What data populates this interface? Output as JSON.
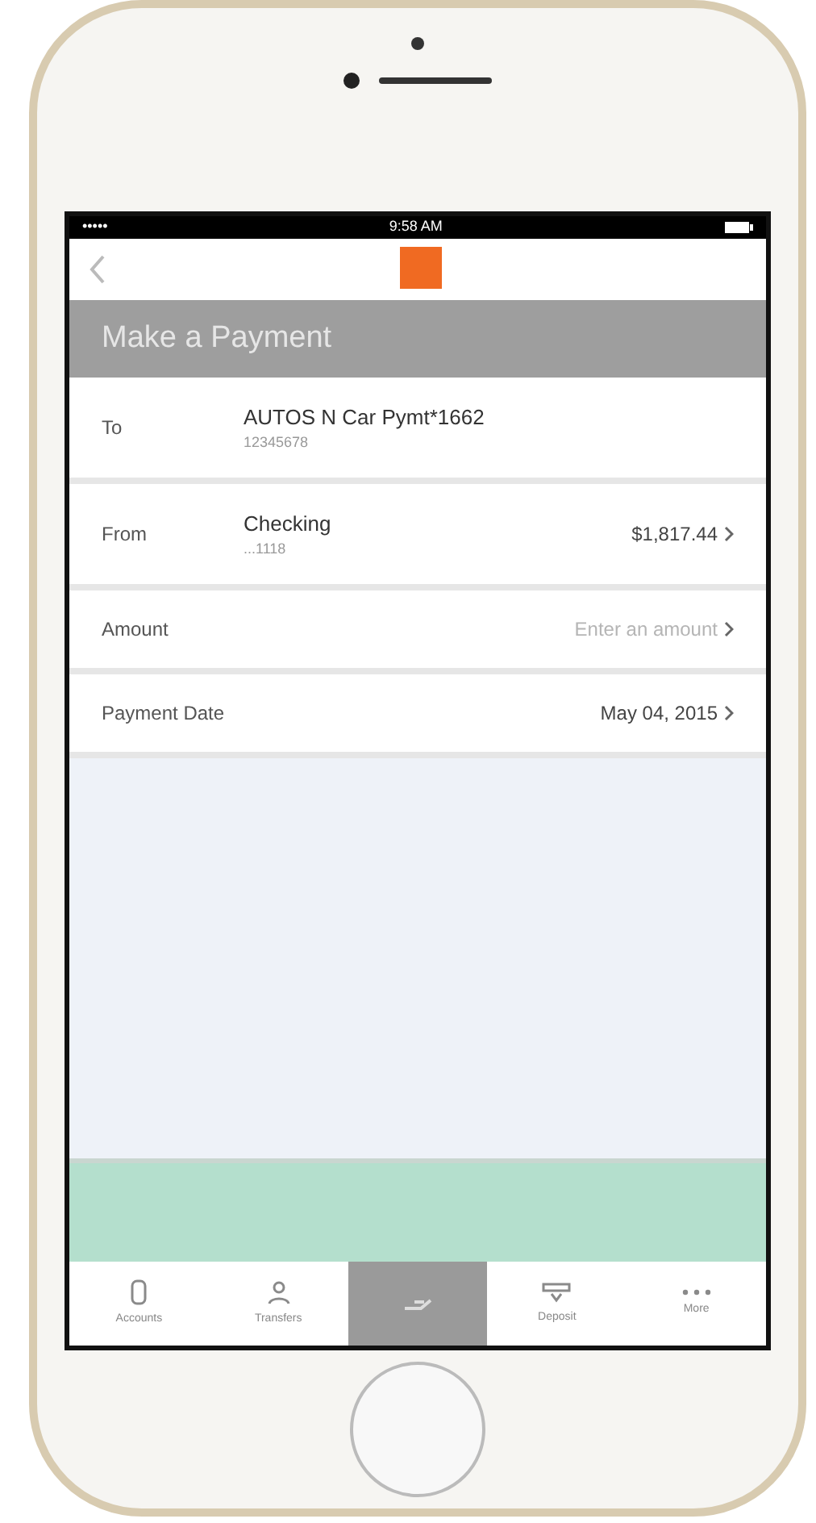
{
  "status_bar": {
    "carrier": "•••••",
    "time": "9:58 AM"
  },
  "header": {
    "title": "Make a Payment"
  },
  "rows": [
    {
      "label": "To",
      "value": "AUTOS N Car Pymt*1662",
      "detail": "12345678"
    },
    {
      "label": "From",
      "value": "Checking",
      "detail": "...1118",
      "amount": "$1,817.44"
    },
    {
      "label": "Amount",
      "amount": "Enter an amount",
      "placeholder": true
    },
    {
      "label": "Payment Date",
      "amount": "May 04, 2015",
      "placeholder": false
    }
  ],
  "tabs": [
    {
      "label": "Accounts",
      "kind": "card",
      "selected": false
    },
    {
      "label": "Transfers",
      "kind": "people",
      "selected": false
    },
    {
      "kind": "pay",
      "selected": true
    },
    {
      "label": "Deposit",
      "kind": "deposit",
      "selected": false
    },
    {
      "label": "More",
      "kind": "more",
      "selected": false
    }
  ]
}
